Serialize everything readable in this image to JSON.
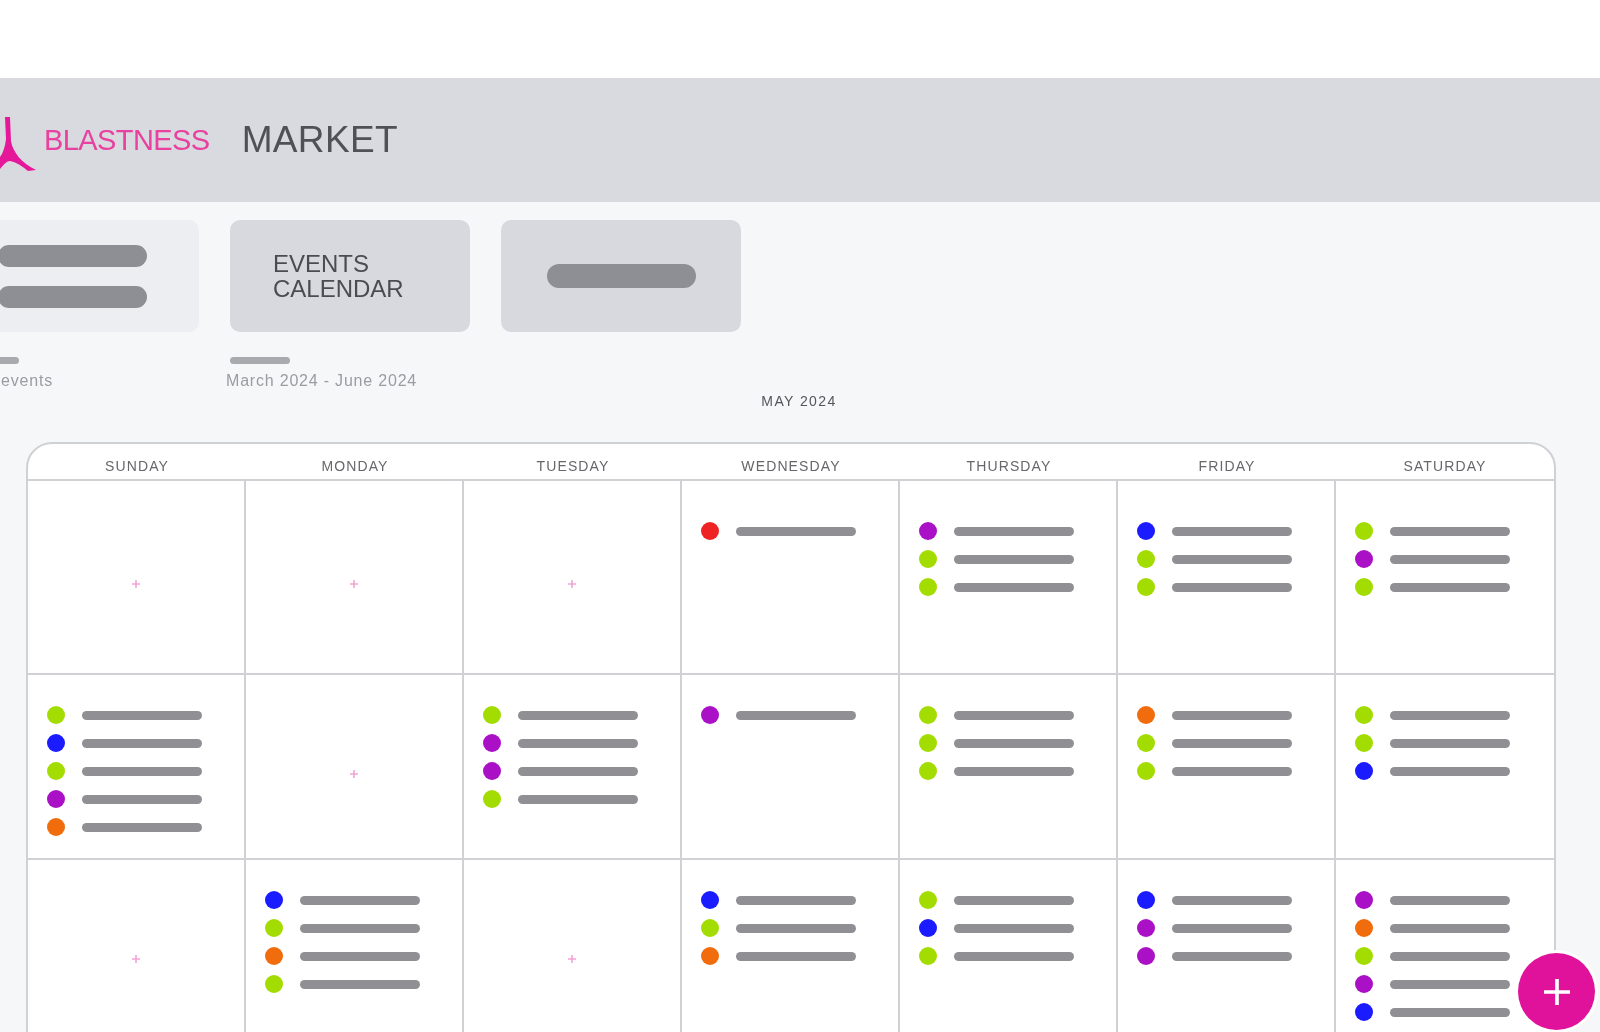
{
  "header": {
    "logo_text": "BLASTNESS",
    "title": "MARKET"
  },
  "cards": [
    {
      "kind": "placeholder_pair",
      "caption": "events"
    },
    {
      "kind": "label",
      "label": "EVENTS CALENDAR",
      "caption": "March 2024 - June 2024"
    },
    {
      "kind": "placeholder"
    }
  ],
  "calendar": {
    "title": "MAY 2024",
    "weekdays": [
      "SUNDAY",
      "MONDAY",
      "TUESDAY",
      "WEDNESDAY",
      "THURSDAY",
      "FRIDAY",
      "SATURDAY"
    ],
    "weeks": [
      {
        "days": [
          {
            "kind": "add"
          },
          {
            "kind": "add"
          },
          {
            "kind": "add"
          },
          {
            "kind": "events",
            "events": [
              {
                "color": "#ee2424"
              }
            ]
          },
          {
            "kind": "events",
            "events": [
              {
                "color": "#aa11c6"
              },
              {
                "color": "#a3dc00"
              },
              {
                "color": "#a3dc00"
              }
            ]
          },
          {
            "kind": "events",
            "events": [
              {
                "color": "#1b1bff"
              },
              {
                "color": "#a3dc00"
              },
              {
                "color": "#a3dc00"
              }
            ]
          },
          {
            "kind": "events",
            "events": [
              {
                "color": "#a3dc00"
              },
              {
                "color": "#aa11c6"
              },
              {
                "color": "#a3dc00"
              }
            ]
          }
        ]
      },
      {
        "days": [
          {
            "kind": "events",
            "events": [
              {
                "color": "#a3dc00"
              },
              {
                "color": "#1b1bff"
              },
              {
                "color": "#a3dc00"
              },
              {
                "color": "#aa11c6"
              },
              {
                "color": "#f06c0c"
              }
            ]
          },
          {
            "kind": "add"
          },
          {
            "kind": "events",
            "events": [
              {
                "color": "#a3dc00"
              },
              {
                "color": "#aa11c6"
              },
              {
                "color": "#aa11c6"
              },
              {
                "color": "#a3dc00"
              }
            ]
          },
          {
            "kind": "events",
            "events": [
              {
                "color": "#aa11c6"
              }
            ]
          },
          {
            "kind": "events",
            "events": [
              {
                "color": "#a3dc00"
              },
              {
                "color": "#a3dc00"
              },
              {
                "color": "#a3dc00"
              }
            ]
          },
          {
            "kind": "events",
            "events": [
              {
                "color": "#f06c0c"
              },
              {
                "color": "#a3dc00"
              },
              {
                "color": "#a3dc00"
              }
            ]
          },
          {
            "kind": "events",
            "events": [
              {
                "color": "#a3dc00"
              },
              {
                "color": "#a3dc00"
              },
              {
                "color": "#1b1bff"
              }
            ]
          }
        ]
      },
      {
        "days": [
          {
            "kind": "add"
          },
          {
            "kind": "events",
            "events": [
              {
                "color": "#1b1bff"
              },
              {
                "color": "#a3dc00"
              },
              {
                "color": "#f06c0c"
              },
              {
                "color": "#a3dc00"
              }
            ]
          },
          {
            "kind": "add"
          },
          {
            "kind": "events",
            "events": [
              {
                "color": "#1b1bff"
              },
              {
                "color": "#a3dc00"
              },
              {
                "color": "#f06c0c"
              }
            ]
          },
          {
            "kind": "events",
            "events": [
              {
                "color": "#a3dc00"
              },
              {
                "color": "#1b1bff"
              },
              {
                "color": "#a3dc00"
              }
            ]
          },
          {
            "kind": "events",
            "events": [
              {
                "color": "#1b1bff"
              },
              {
                "color": "#aa11c6"
              },
              {
                "color": "#aa11c6"
              }
            ]
          },
          {
            "kind": "events",
            "events": [
              {
                "color": "#aa11c6"
              },
              {
                "color": "#f06c0c"
              },
              {
                "color": "#a3dc00"
              },
              {
                "color": "#aa11c6"
              },
              {
                "color": "#1b1bff"
              }
            ]
          }
        ]
      }
    ]
  }
}
